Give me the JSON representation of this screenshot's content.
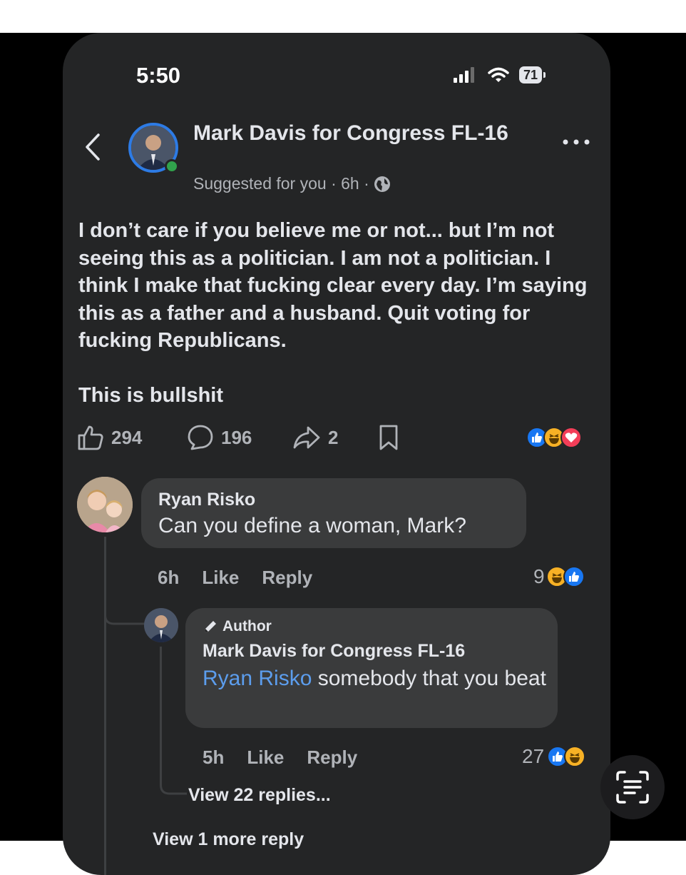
{
  "status_bar": {
    "time": "5:50",
    "battery": "71"
  },
  "post": {
    "page_name": "Mark Davis for Congress FL-16",
    "meta": "Suggested for you · 6h ·",
    "paragraph1": "I don’t care if you believe me or not... but I’m not seeing this as a politician. I am not a politician. I think I make that fucking clear every day. I’m saying this as a father and a husband. Quit voting for fucking Republicans.",
    "paragraph2": "This is bullshit",
    "likes": "294",
    "comments": "196",
    "shares": "2",
    "reaction_icons": [
      "like-reaction-icon",
      "haha-reaction-icon",
      "love-reaction-icon"
    ]
  },
  "comment1": {
    "author": "Ryan Risko",
    "text": "Can you define a woman, Mark?",
    "time": "6h",
    "like_label": "Like",
    "reply_label": "Reply",
    "reaction_count": "9"
  },
  "reply1": {
    "badge": "Author",
    "author": "Mark Davis for Congress FL-16",
    "mention": "Ryan Risko",
    "text": " somebody that you beat",
    "time": "5h",
    "like_label": "Like",
    "reply_label": "Reply",
    "reaction_count": "27"
  },
  "view_replies": "View 22 replies...",
  "view_more": "View 1 more reply",
  "colors": {
    "background": "#242526",
    "bubble": "#3a3b3c",
    "text": "#e4e6eb",
    "muted": "#b0b3b8",
    "link": "#5c9ded",
    "brand_blue": "#1877f2"
  }
}
